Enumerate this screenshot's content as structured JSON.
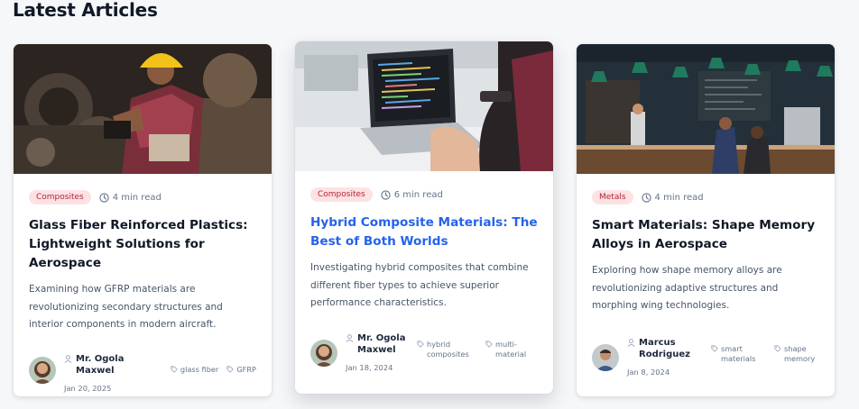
{
  "section": {
    "title": "Latest Articles"
  },
  "articles": [
    {
      "category": "Composites",
      "read_time": "4 min read",
      "title": "Glass Fiber Reinforced Plastics: Lightweight Solutions for Aerospace",
      "excerpt": "Examining how GFRP materials are revolutionizing secondary structures and interior components in modern aircraft.",
      "author": "Mr. Ogola Maxwel",
      "date": "Jan 20, 2025",
      "tags": [
        "glass fiber",
        "GFRP"
      ]
    },
    {
      "category": "Composites",
      "read_time": "6 min read",
      "title": "Hybrid Composite Materials: The Best of Both Worlds",
      "excerpt": "Investigating hybrid composites that combine different fiber types to achieve superior performance characteristics.",
      "author": "Mr. Ogola Maxwel",
      "date": "Jan 18, 2024",
      "tags": [
        "hybrid composites",
        "multi-material"
      ]
    },
    {
      "category": "Metals",
      "read_time": "4 min read",
      "title": "Smart Materials: Shape Memory Alloys in Aerospace",
      "excerpt": "Exploring how shape memory alloys are revolutionizing adaptive structures and morphing wing technologies.",
      "author": "Marcus Rodriguez",
      "date": "Jan 8, 2024",
      "tags": [
        "smart materials",
        "shape memory"
      ]
    }
  ],
  "colors": {
    "badge_bg": "#fde2e4",
    "badge_text": "#b4233a",
    "link_blue": "#2563eb",
    "page_bg": "#f6f7f9"
  }
}
